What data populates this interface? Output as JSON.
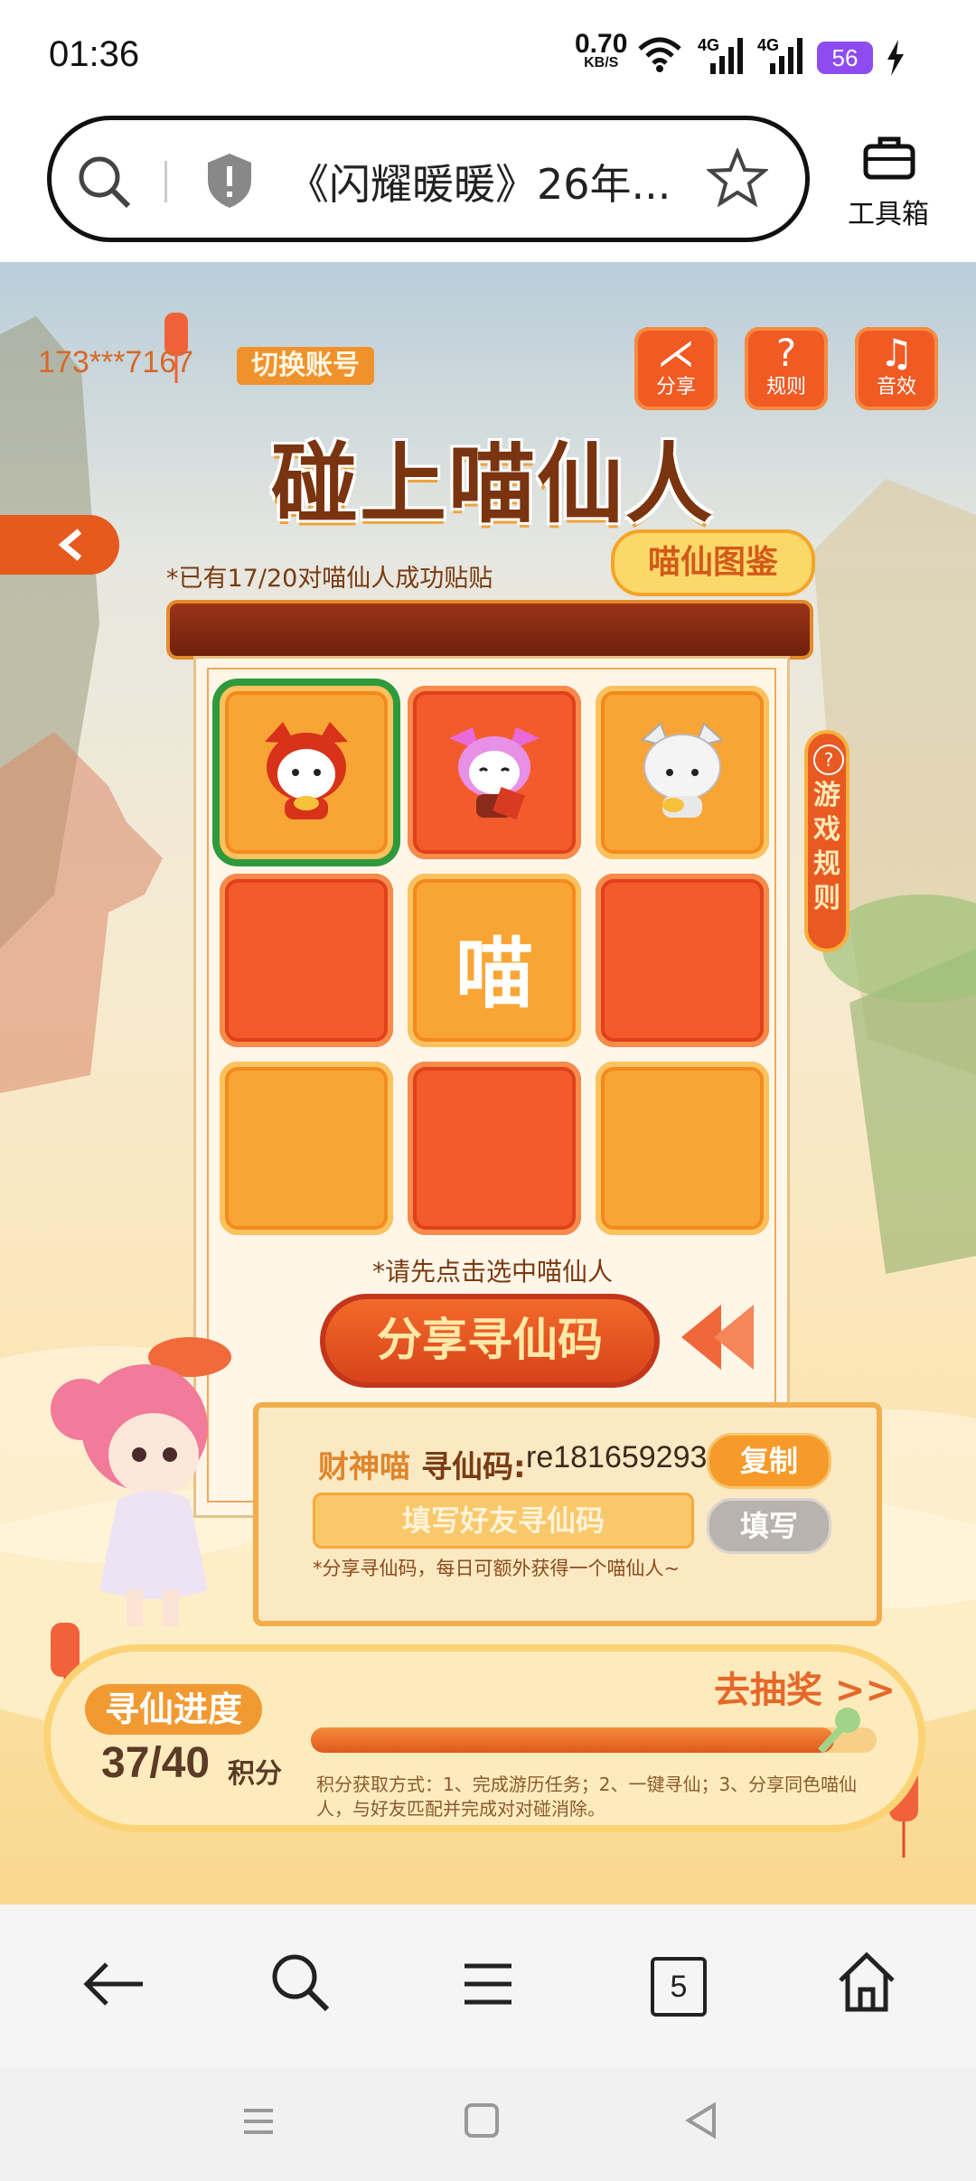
{
  "status_bar": {
    "time": "01:36",
    "net_speed_value": "0.70",
    "net_speed_unit": "KB/S",
    "signal1_label": "4G",
    "signal2_label": "4G",
    "battery": "56"
  },
  "browser": {
    "page_title": "《闪耀暖暖》26年...",
    "toolbox_label": "工具箱",
    "tab_count": "5"
  },
  "game": {
    "account": "173***7167",
    "switch_account": "切换账号",
    "top_buttons": [
      {
        "icon": "share-icon",
        "label": "分享"
      },
      {
        "icon": "rules-icon",
        "label": "规则"
      },
      {
        "icon": "music-icon",
        "label": "音效"
      }
    ],
    "title": "碰上喵仙人",
    "paired_status": "*已有17/20对喵仙人成功贴贴",
    "catalog_button": "喵仙图鉴",
    "rules_side_tab": "游戏规则",
    "center_tile_text": "喵",
    "select_hint": "*请先点击选中喵仙人",
    "share_code_button": "分享寻仙码",
    "code_owner": "财神喵",
    "code_label": "寻仙码:",
    "code_value": "re181659293",
    "copy_button": "复制",
    "friend_code_placeholder": "填写好友寻仙码",
    "fill_button": "填写",
    "code_note": "*分享寻仙码，每日可额外获得一个喵仙人~",
    "progress_label": "寻仙进度",
    "score": "37/40",
    "score_unit": "积分",
    "progress_fraction": 0.925,
    "lottery_link": "去抽奖 >>",
    "earn_note": "积分获取方式：1、完成游历任务；2、一键寻仙；3、分享同色喵仙人，与好友匹配并完成对对碰消除。"
  }
}
